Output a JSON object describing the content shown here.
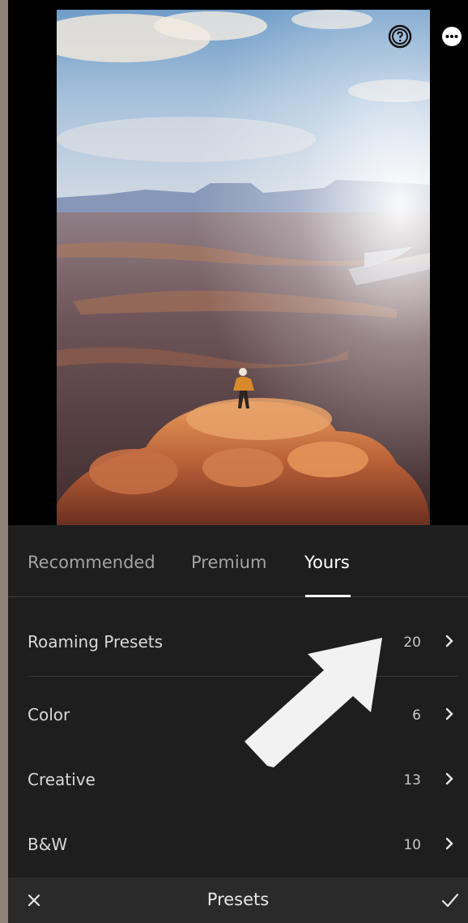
{
  "photo": {
    "alt_icon": "landscape-photo"
  },
  "toolbar": {
    "help_icon": "help-icon",
    "more_icon": "more-icon"
  },
  "tabs": [
    {
      "label": "Recommended",
      "active": false
    },
    {
      "label": "Premium",
      "active": false
    },
    {
      "label": "Yours",
      "active": true
    }
  ],
  "presets": [
    {
      "label": "Roaming Presets",
      "count": "20"
    },
    {
      "label": "Color",
      "count": "6"
    },
    {
      "label": "Creative",
      "count": "13"
    },
    {
      "label": "B&W",
      "count": "10"
    }
  ],
  "bottom_bar": {
    "title": "Presets",
    "close_icon": "close-icon",
    "confirm_icon": "checkmark-icon"
  },
  "colors": {
    "panel_bg": "#1e1e1e",
    "bar_bg": "#2a2a2a",
    "active_tab": "#ffffff",
    "inactive_tab": "#a3a3a3",
    "side_frame": "#8c8276"
  }
}
